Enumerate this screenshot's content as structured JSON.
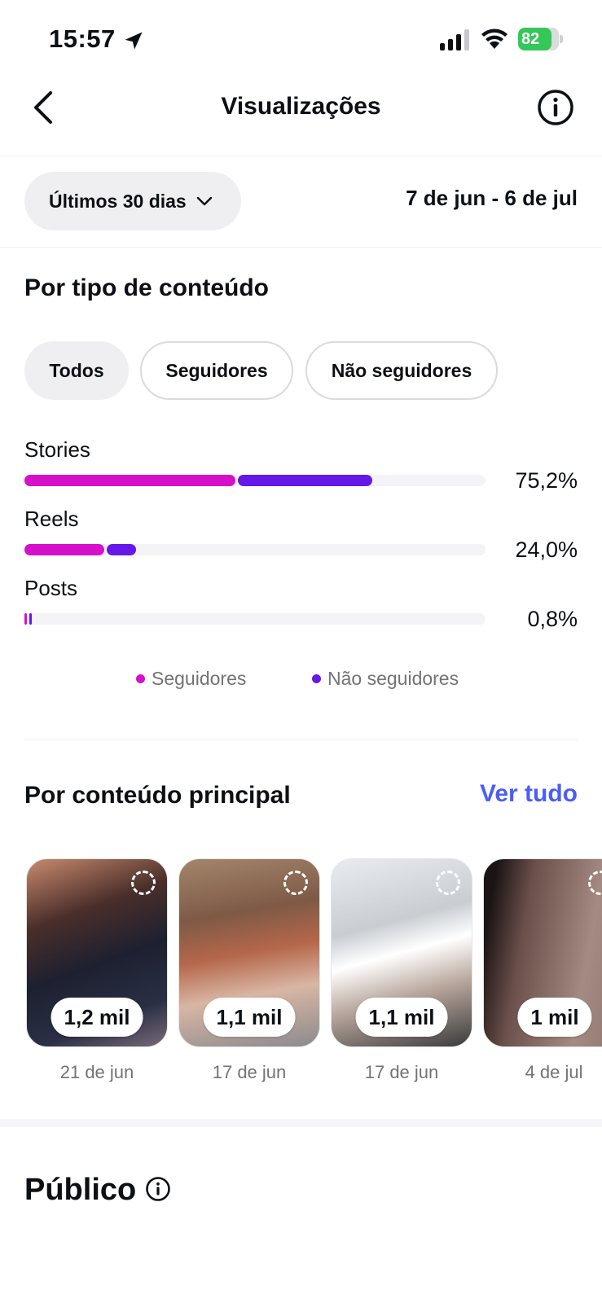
{
  "status_bar": {
    "time": "15:57",
    "battery": "82"
  },
  "header": {
    "title": "Visualizações"
  },
  "filters": {
    "period_label": "Últimos 30 dias",
    "date_range": "7 de jun - 6 de jul"
  },
  "content_type": {
    "title": "Por tipo de conteúdo",
    "chips": [
      "Todos",
      "Seguidores",
      "Não seguidores"
    ],
    "rows": [
      {
        "label": "Stories",
        "value": "75,2%"
      },
      {
        "label": "Reels",
        "value": "24,0%"
      },
      {
        "label": "Posts",
        "value": "0,8%"
      }
    ],
    "legend": {
      "followers": "Seguidores",
      "non_followers": "Não seguidores"
    }
  },
  "chart_data": {
    "type": "bar",
    "orientation": "horizontal",
    "stacked": true,
    "categories": [
      "Stories",
      "Reels",
      "Posts"
    ],
    "series": [
      {
        "name": "Seguidores",
        "values": [
          46.1,
          17.6,
          0.4
        ]
      },
      {
        "name": "Não seguidores",
        "values": [
          29.1,
          6.4,
          0.4
        ]
      }
    ],
    "totals": [
      75.2,
      24.0,
      0.8
    ],
    "colors": {
      "Seguidores": "#d60fcb",
      "Não seguidores": "#6518e8"
    },
    "xlim": [
      0,
      100
    ]
  },
  "top_content": {
    "title": "Por conteúdo principal",
    "see_all": "Ver tudo",
    "items": [
      {
        "count": "1,2 mil",
        "date": "21 de jun"
      },
      {
        "count": "1,1 mil",
        "date": "17 de jun"
      },
      {
        "count": "1,1 mil",
        "date": "17 de jun"
      },
      {
        "count": "1 mil",
        "date": "4 de jul"
      }
    ]
  },
  "audience": {
    "title": "Público"
  },
  "icons": {
    "back": "chevron-left-icon",
    "info": "info-icon",
    "location": "location-arrow-icon",
    "signal": "cellular-signal-icon",
    "wifi": "wifi-icon",
    "battery": "battery-icon",
    "dropdown": "chevron-down-icon"
  }
}
